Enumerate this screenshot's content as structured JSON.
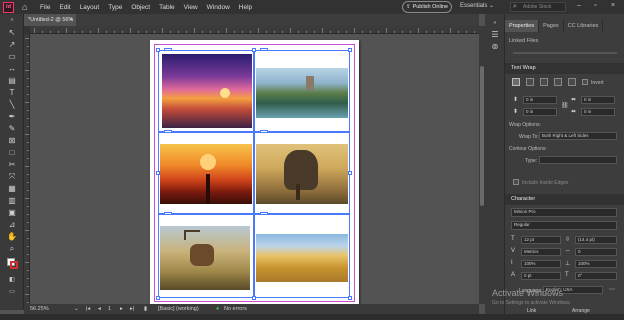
{
  "menubar": {
    "logo": "Id",
    "items": [
      "File",
      "Edit",
      "Layout",
      "Type",
      "Object",
      "Table",
      "View",
      "Window",
      "Help"
    ],
    "publish_label": "Publish Online",
    "workspace": "Essentials",
    "search_placeholder": "Adobe Stock"
  },
  "document": {
    "tab_label": "*Untitled-2 @ 56%",
    "close_glyph": "×"
  },
  "status": {
    "zoom": "56.25%",
    "page_number": "1",
    "style": "[Basic] (working)",
    "errors": "No errors"
  },
  "right_panel": {
    "tabs": [
      "Properties",
      "Pages",
      "CC Libraries"
    ],
    "linked_files": "Linked Files",
    "text_wrap": {
      "title": "Text Wrap",
      "invert": "Invert",
      "offsets": [
        "0 in",
        "0 in",
        "0 in",
        "0 in"
      ],
      "wrap_options": "Wrap Options:",
      "wrap_to_label": "Wrap To:",
      "wrap_to_value": "Both Right & Left Sides",
      "contour_options": "Contour Options:",
      "type_label": "Type:",
      "include_inside_edges": "Include Inside Edges"
    },
    "character": {
      "title": "Character",
      "font": "Minion Pro",
      "style": "Regular",
      "size": "12 pt",
      "leading": "(14.4 pt)",
      "kerning": "Metrics",
      "tracking": "0",
      "v_scale": "100%",
      "h_scale": "100%",
      "baseline": "0 pt",
      "skew": "0°",
      "language_label": "Language:",
      "language": "English: USA"
    },
    "buttons": {
      "link": "Link",
      "arrange": "Arrange"
    }
  },
  "watermark": {
    "line1": "Activate Windows",
    "line2": "Go to Settings to activate Windows."
  },
  "images": [
    {
      "name": "sunset-sea",
      "colors": [
        "#2a1d6e",
        "#c05a9a",
        "#f29a3a",
        "#3b2244"
      ]
    },
    {
      "name": "lake-island",
      "colors": [
        "#9fc1d9",
        "#5d7e4a",
        "#2f5d4a",
        "#6aa0b0"
      ]
    },
    {
      "name": "pier-sunset",
      "colors": [
        "#f7b23a",
        "#e0551c",
        "#7a1a0e",
        "#3a0e08"
      ]
    },
    {
      "name": "elephant",
      "colors": [
        "#cfa85c",
        "#8a6a3a",
        "#4a3a2a",
        "#b98a44"
      ]
    },
    {
      "name": "deer",
      "colors": [
        "#9db6c8",
        "#b89a5a",
        "#7a6a3a",
        "#5a4a2a"
      ]
    },
    {
      "name": "wheat",
      "colors": [
        "#8ab8e0",
        "#d9b04a",
        "#a87a2a",
        "#f0d07a"
      ]
    }
  ],
  "accent": "#4a78ff",
  "margin_color": "#c84fd0"
}
